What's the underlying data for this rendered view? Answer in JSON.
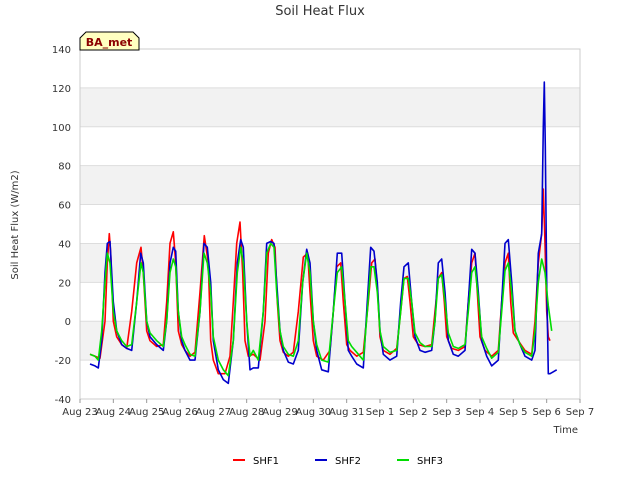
{
  "chart_data": {
    "type": "line",
    "title": "Soil Heat Flux",
    "xlabel": "Time",
    "ylabel": "Soil Heat Flux (W/m2)",
    "badge": "BA_met",
    "ylim": [
      -40,
      140
    ],
    "yticks": [
      -40,
      -20,
      0,
      20,
      40,
      60,
      80,
      100,
      120,
      140
    ],
    "xlim": [
      0,
      15
    ],
    "xticks": [
      0,
      1,
      2,
      3,
      4,
      5,
      6,
      7,
      8,
      9,
      10,
      11,
      12,
      13,
      14,
      15
    ],
    "xtick_labels": [
      "Aug 23",
      "Aug 24",
      "Aug 25",
      "Aug 26",
      "Aug 27",
      "Aug 28",
      "Aug 29",
      "Aug 30",
      "Aug 31",
      "Sep 1",
      "Sep 2",
      "Sep 3",
      "Sep 4",
      "Sep 5",
      "Sep 6",
      "Sep 7"
    ],
    "legend_position": "bottom-center",
    "grid": true,
    "series": [
      {
        "name": "SHF1",
        "color": "#ff0000",
        "x": [
          0.3,
          0.45,
          0.6,
          0.75,
          0.82,
          0.88,
          0.92,
          1.0,
          1.1,
          1.25,
          1.4,
          1.55,
          1.7,
          1.83,
          1.9,
          2.0,
          2.1,
          2.3,
          2.5,
          2.6,
          2.7,
          2.8,
          2.87,
          2.95,
          3.05,
          3.15,
          3.3,
          3.45,
          3.6,
          3.73,
          3.85,
          3.92,
          4.0,
          4.15,
          4.35,
          4.5,
          4.6,
          4.7,
          4.8,
          4.88,
          4.95,
          5.05,
          5.2,
          5.4,
          5.55,
          5.65,
          5.75,
          5.85,
          5.92,
          6.0,
          6.1,
          6.25,
          6.4,
          6.55,
          6.7,
          6.83,
          6.9,
          7.0,
          7.1,
          7.3,
          7.5,
          7.6,
          7.7,
          7.82,
          7.9,
          8.0,
          8.1,
          8.3,
          8.5,
          8.65,
          8.75,
          8.85,
          8.93,
          9.0,
          9.1,
          9.3,
          9.5,
          9.62,
          9.72,
          9.82,
          9.9,
          10.0,
          10.15,
          10.35,
          10.55,
          10.65,
          10.75,
          10.85,
          10.93,
          11.0,
          11.15,
          11.35,
          11.55,
          11.65,
          11.75,
          11.85,
          11.92,
          12.0,
          12.15,
          12.35,
          12.55,
          12.65,
          12.75,
          12.85,
          12.92,
          13.0,
          13.15,
          13.35,
          13.55,
          13.65,
          13.75,
          13.85,
          13.9,
          13.95,
          14.0,
          14.05,
          14.1
        ],
        "y": [
          -17,
          -18,
          -19,
          0,
          30,
          45,
          35,
          0,
          -8,
          -12,
          -14,
          5,
          30,
          38,
          25,
          -5,
          -10,
          -13,
          -12,
          10,
          40,
          46,
          30,
          -5,
          -12,
          -15,
          -18,
          -16,
          15,
          44,
          30,
          -10,
          -20,
          -27,
          -27,
          -18,
          10,
          40,
          51,
          25,
          -10,
          -18,
          -17,
          -20,
          0,
          35,
          42,
          38,
          10,
          -10,
          -16,
          -18,
          -16,
          5,
          33,
          35,
          15,
          -10,
          -18,
          -20,
          -15,
          5,
          28,
          30,
          10,
          -12,
          -15,
          -18,
          -16,
          10,
          30,
          32,
          15,
          -8,
          -15,
          -17,
          -14,
          5,
          22,
          23,
          10,
          -8,
          -12,
          -13,
          -12,
          5,
          22,
          25,
          10,
          -8,
          -14,
          -15,
          -13,
          10,
          30,
          35,
          15,
          -8,
          -15,
          -18,
          -15,
          10,
          30,
          35,
          10,
          -6,
          -10,
          -15,
          -17,
          0,
          30,
          45,
          68,
          40,
          5,
          -8,
          -10
        ]
      },
      {
        "name": "SHF2",
        "color": "#0000cc",
        "x": [
          0.3,
          0.45,
          0.55,
          0.65,
          0.75,
          0.82,
          0.9,
          1.0,
          1.1,
          1.25,
          1.4,
          1.55,
          1.7,
          1.82,
          1.9,
          2.0,
          2.1,
          2.3,
          2.5,
          2.6,
          2.7,
          2.8,
          2.87,
          2.95,
          3.05,
          3.15,
          3.3,
          3.45,
          3.6,
          3.72,
          3.82,
          3.92,
          4.0,
          4.15,
          4.3,
          4.45,
          4.6,
          4.72,
          4.82,
          4.9,
          5.0,
          5.1,
          5.2,
          5.35,
          5.5,
          5.6,
          5.72,
          5.82,
          5.9,
          6.0,
          6.1,
          6.25,
          6.4,
          6.55,
          6.68,
          6.8,
          6.9,
          7.0,
          7.1,
          7.25,
          7.45,
          7.6,
          7.72,
          7.85,
          7.95,
          8.05,
          8.15,
          8.3,
          8.5,
          8.62,
          8.72,
          8.82,
          8.92,
          9.0,
          9.1,
          9.3,
          9.5,
          9.62,
          9.72,
          9.85,
          9.95,
          10.05,
          10.2,
          10.35,
          10.55,
          10.65,
          10.75,
          10.85,
          10.95,
          11.05,
          11.2,
          11.35,
          11.55,
          11.65,
          11.75,
          11.85,
          11.95,
          12.05,
          12.2,
          12.35,
          12.55,
          12.65,
          12.75,
          12.85,
          12.95,
          13.05,
          13.2,
          13.35,
          13.55,
          13.65,
          13.75,
          13.85,
          13.9,
          13.93,
          13.96,
          14.0,
          14.05,
          14.1,
          14.2,
          14.3
        ],
        "y": [
          -22,
          -23,
          -24,
          -10,
          25,
          40,
          41,
          10,
          -5,
          -12,
          -14,
          -15,
          10,
          35,
          30,
          0,
          -8,
          -12,
          -15,
          0,
          30,
          38,
          36,
          5,
          -10,
          -15,
          -20,
          -20,
          5,
          40,
          38,
          20,
          -10,
          -25,
          -30,
          -32,
          -10,
          30,
          42,
          38,
          0,
          -25,
          -24,
          -24,
          5,
          40,
          41,
          40,
          20,
          -5,
          -15,
          -21,
          -22,
          -15,
          20,
          37,
          30,
          0,
          -15,
          -25,
          -26,
          5,
          35,
          35,
          10,
          -15,
          -18,
          -22,
          -24,
          10,
          38,
          36,
          20,
          -5,
          -17,
          -20,
          -18,
          10,
          28,
          30,
          10,
          -8,
          -15,
          -16,
          -15,
          0,
          30,
          32,
          15,
          -10,
          -17,
          -18,
          -15,
          10,
          37,
          35,
          15,
          -10,
          -18,
          -23,
          -20,
          10,
          40,
          42,
          20,
          -5,
          -12,
          -18,
          -20,
          -15,
          35,
          45,
          100,
          123,
          90,
          20,
          -27,
          -27,
          -26,
          -25
        ]
      },
      {
        "name": "SHF3",
        "color": "#00dd00",
        "x": [
          0.3,
          0.45,
          0.55,
          0.65,
          0.75,
          0.82,
          0.9,
          1.0,
          1.1,
          1.25,
          1.4,
          1.55,
          1.7,
          1.83,
          1.9,
          2.0,
          2.1,
          2.3,
          2.5,
          2.6,
          2.7,
          2.8,
          2.87,
          2.95,
          3.05,
          3.15,
          3.3,
          3.45,
          3.6,
          3.72,
          3.82,
          3.92,
          4.0,
          4.15,
          4.3,
          4.45,
          4.6,
          4.72,
          4.82,
          4.9,
          5.0,
          5.1,
          5.2,
          5.35,
          5.5,
          5.6,
          5.72,
          5.82,
          5.9,
          6.0,
          6.1,
          6.25,
          6.4,
          6.55,
          6.68,
          6.8,
          6.9,
          7.0,
          7.1,
          7.25,
          7.45,
          7.6,
          7.72,
          7.85,
          7.95,
          8.05,
          8.15,
          8.3,
          8.5,
          8.62,
          8.72,
          8.82,
          8.92,
          9.0,
          9.1,
          9.3,
          9.5,
          9.62,
          9.72,
          9.85,
          9.95,
          10.05,
          10.2,
          10.35,
          10.55,
          10.65,
          10.75,
          10.85,
          10.95,
          11.05,
          11.2,
          11.35,
          11.55,
          11.65,
          11.75,
          11.85,
          11.95,
          12.05,
          12.2,
          12.35,
          12.55,
          12.65,
          12.75,
          12.85,
          12.95,
          13.05,
          13.2,
          13.35,
          13.55,
          13.65,
          13.75,
          13.85,
          13.95,
          14.05,
          14.15
        ],
        "y": [
          -17,
          -18,
          -20,
          -5,
          20,
          35,
          30,
          5,
          -5,
          -10,
          -13,
          -12,
          10,
          30,
          25,
          0,
          -6,
          -10,
          -13,
          0,
          25,
          32,
          28,
          5,
          -8,
          -12,
          -17,
          -18,
          5,
          35,
          30,
          15,
          -8,
          -20,
          -25,
          -28,
          -10,
          25,
          38,
          30,
          0,
          -18,
          -15,
          -20,
          5,
          35,
          40,
          38,
          15,
          -5,
          -13,
          -17,
          -18,
          -10,
          20,
          35,
          25,
          0,
          -12,
          -20,
          -21,
          5,
          25,
          28,
          10,
          -10,
          -13,
          -16,
          -20,
          5,
          28,
          28,
          15,
          -5,
          -13,
          -16,
          -15,
          5,
          22,
          22,
          10,
          -6,
          -11,
          -13,
          -13,
          0,
          22,
          24,
          10,
          -6,
          -13,
          -14,
          -12,
          5,
          25,
          28,
          12,
          -8,
          -14,
          -19,
          -16,
          5,
          26,
          30,
          15,
          -5,
          -12,
          -16,
          -18,
          -5,
          20,
          32,
          25,
          8,
          -5
        ]
      }
    ]
  }
}
